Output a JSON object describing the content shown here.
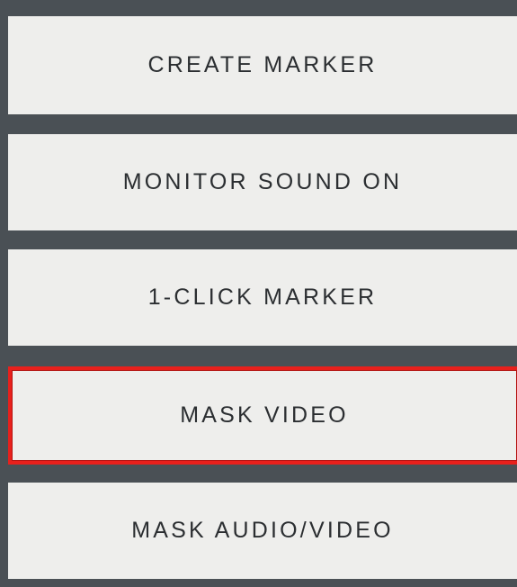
{
  "menu": {
    "items": [
      {
        "label": "CREATE MARKER",
        "highlighted": false
      },
      {
        "label": "MONITOR SOUND ON",
        "highlighted": false
      },
      {
        "label": "1-CLICK MARKER",
        "highlighted": false
      },
      {
        "label": "MASK VIDEO",
        "highlighted": true
      },
      {
        "label": "MASK AUDIO/VIDEO",
        "highlighted": false
      }
    ]
  },
  "colors": {
    "background": "#4a5055",
    "button": "#eeeeec",
    "text": "#2b2e31",
    "highlight": "#e8201c"
  }
}
